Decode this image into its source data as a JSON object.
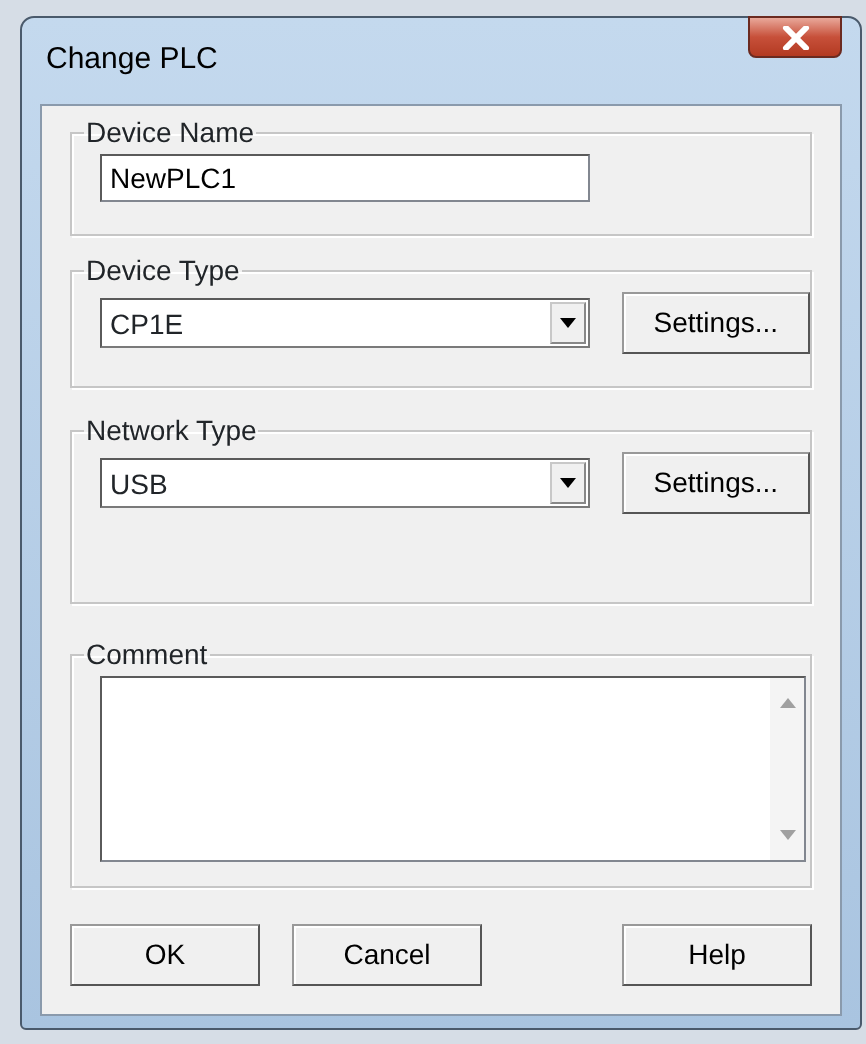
{
  "window": {
    "title": "Change PLC"
  },
  "groups": [
    {
      "kind": "text",
      "label": "Device Name",
      "value": "NewPLC1"
    },
    {
      "kind": "combo",
      "label": "Device Type",
      "value": "CP1E",
      "button": "Settings..."
    },
    {
      "kind": "combo",
      "label": "Network Type",
      "value": "USB",
      "button": "Settings..."
    },
    {
      "kind": "memo",
      "label": "Comment"
    }
  ],
  "buttons": [
    {
      "label": "OK"
    },
    {
      "label": "Cancel"
    },
    {
      "label": "Help"
    }
  ]
}
